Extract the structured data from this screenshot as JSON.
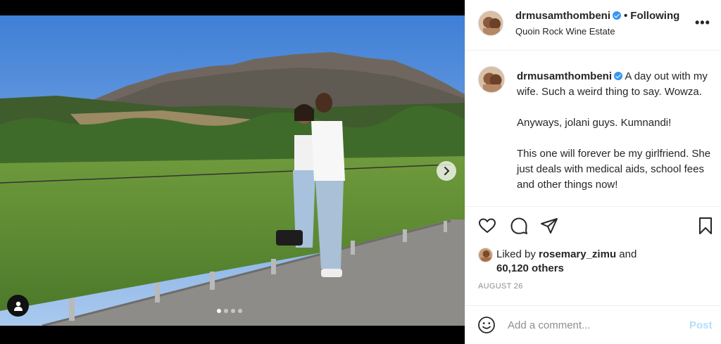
{
  "post": {
    "username": "drmusamthombeni",
    "separator": "•",
    "follow_label": "Following",
    "location": "Quoin Rock Wine Estate",
    "more_label": "•••"
  },
  "caption": {
    "username": "drmusamthombeni",
    "text": "A day out with my wife. Such a weird thing to say. Wowza.\n\nAnyways, jolani guys. Kumnandi!\n\nThis one will forever be my girlfriend. She just deals with medical aids, school fees and other things now!"
  },
  "likes": {
    "prefix": "Liked by",
    "user": "rosemary_zimu",
    "conjunction": "and",
    "others": "60,120 others"
  },
  "date": "AUGUST 26",
  "comment": {
    "placeholder": "Add a comment...",
    "post_label": "Post"
  },
  "carousel": {
    "slide_count": 4,
    "active_index": 0
  },
  "icons": {
    "like": "heart-icon",
    "comment": "comment-icon",
    "share": "paper-plane-icon",
    "save": "bookmark-icon",
    "emoji": "smiley-icon",
    "next": "chevron-right-icon",
    "tag": "user-tag-icon"
  },
  "colors": {
    "verified": "#3897f0",
    "post_button": "#b2dffc",
    "muted_text": "#8e8e8e"
  }
}
